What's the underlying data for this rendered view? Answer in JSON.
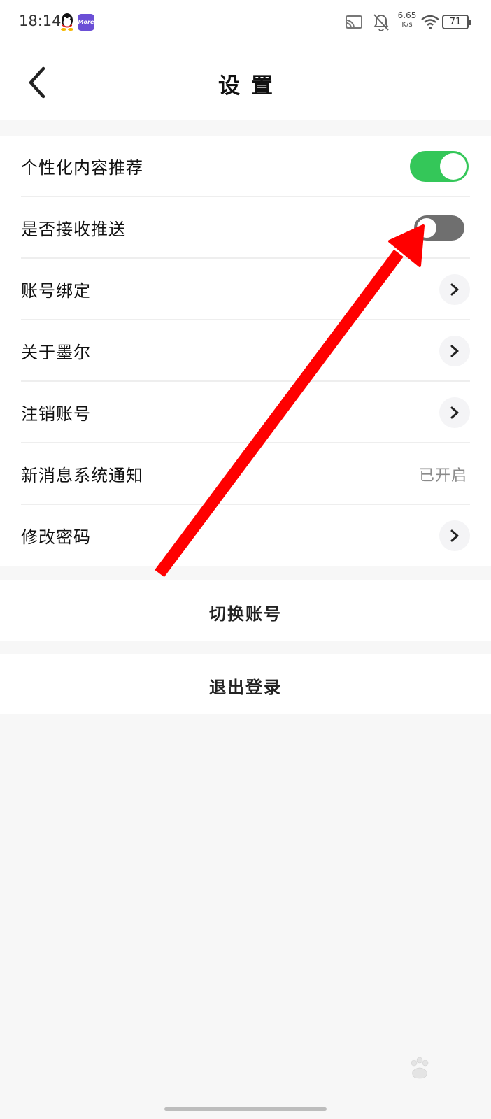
{
  "status_bar": {
    "time": "18:14",
    "app_badge": "More",
    "net_speed_value": "6.65",
    "net_speed_unit": "K/s",
    "battery": "71"
  },
  "header": {
    "title": "设置"
  },
  "settings": {
    "items": [
      {
        "label": "个性化内容推荐",
        "control": "toggle",
        "on": true
      },
      {
        "label": "是否接收推送",
        "control": "toggle",
        "on": false
      },
      {
        "label": "账号绑定",
        "control": "chevron"
      },
      {
        "label": "关于墨尔",
        "control": "chevron"
      },
      {
        "label": "注销账号",
        "control": "chevron"
      },
      {
        "label": "新消息系统通知",
        "control": "value",
        "value": "已开启"
      },
      {
        "label": "修改密码",
        "control": "chevron"
      }
    ]
  },
  "actions": {
    "switch_account": "切换账号",
    "logout": "退出登录"
  },
  "colors": {
    "toggle_on": "#34c759",
    "toggle_off": "#6f6f6f",
    "annotation_arrow": "#ff0000"
  },
  "icons": [
    "qq-icon",
    "more-app-icon",
    "cast-icon",
    "bell-off-icon",
    "wifi-icon",
    "battery-icon",
    "back-arrow-icon",
    "chevron-right-icon",
    "red-arrow-annotation",
    "baidu-watermark"
  ]
}
